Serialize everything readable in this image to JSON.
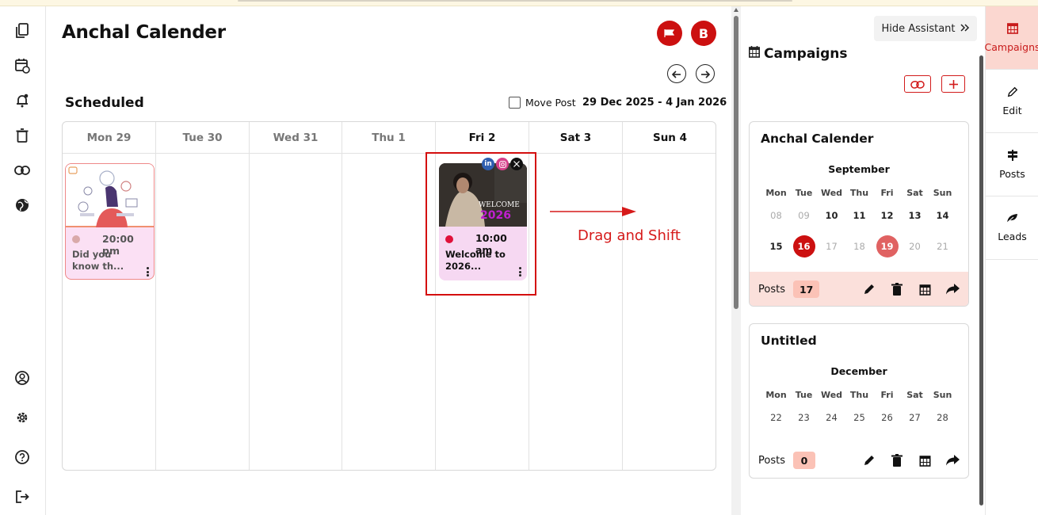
{
  "page": {
    "title": "Anchal Calender"
  },
  "header": {
    "avatar_initial": "B"
  },
  "schedule": {
    "heading": "Scheduled",
    "move_post_label": "Move Post",
    "date_range": "29 Dec 2025 - 4 Jan 2026",
    "days": [
      "Mon 29",
      "Tue 30",
      "Wed 31",
      "Thu 1",
      "Fri 2",
      "Sat 3",
      "Sun 4"
    ]
  },
  "posts": [
    {
      "time": "20:00 pm",
      "text": "Did you know th...",
      "status_color": "#d9a9a9"
    },
    {
      "time": "10:00 am",
      "text": "Welcome to 2026...",
      "status_color": "#e0103a",
      "image_text": "WELCOME 2026"
    }
  ],
  "annotation": {
    "label": "Drag and Shift",
    "color": "#d40e0e"
  },
  "assistant": {
    "hide_label": "Hide Assistant",
    "campaigns_title": "Campaigns",
    "dow": [
      "Mon",
      "Tue",
      "Wed",
      "Thu",
      "Fri",
      "Sat",
      "Sun"
    ],
    "cards": [
      {
        "title": "Anchal Calender",
        "month": "September",
        "week1": [
          "08",
          "09",
          "10",
          "11",
          "12",
          "13",
          "14"
        ],
        "week2": [
          "15",
          "16",
          "17",
          "18",
          "19",
          "20",
          "21"
        ],
        "posts_label": "Posts",
        "posts_count": "17"
      },
      {
        "title": "Untitled",
        "month": "December",
        "week1": [
          "22",
          "23",
          "24",
          "25",
          "26",
          "27",
          "28"
        ],
        "posts_label": "Posts",
        "posts_count": "0"
      }
    ]
  },
  "tabs": [
    {
      "label": "Campaigns",
      "icon": "calendar-icon"
    },
    {
      "label": "Edit",
      "icon": "pencil-icon"
    },
    {
      "label": "Posts",
      "icon": "signpost-icon"
    },
    {
      "label": "Leads",
      "icon": "leaf-icon"
    }
  ],
  "colors": {
    "accent": "#cc1010",
    "tab_active_bg": "#fbd7d0",
    "post_bg": "#f6d8f2"
  }
}
